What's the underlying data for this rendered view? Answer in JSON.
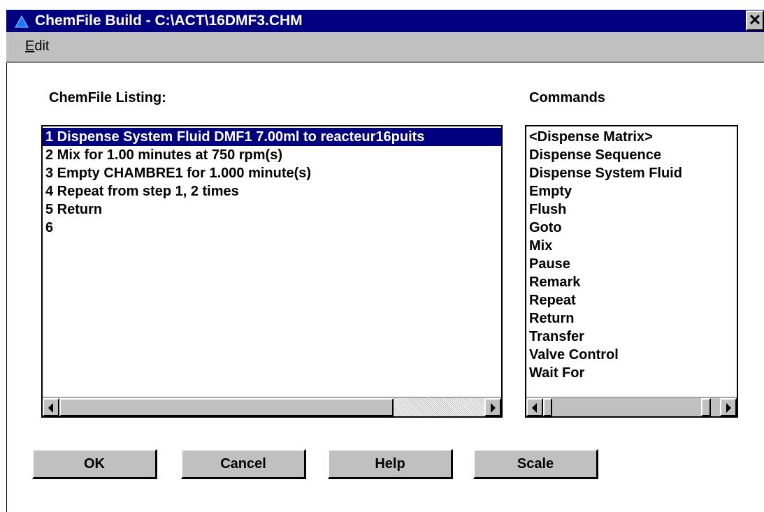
{
  "window": {
    "title": "ChemFile Build - C:\\ACT\\16DMF3.CHM",
    "close_label": "✕"
  },
  "menu": {
    "edit_first": "E",
    "edit_rest": "dit"
  },
  "listing": {
    "label": "ChemFile Listing:",
    "items": [
      "1 Dispense System Fluid DMF1 7.00ml to reacteur16puits",
      "2 Mix for 1.00 minutes  at 750 rpm(s)",
      "3 Empty CHAMBRE1 for 1.000 minute(s)",
      "4 Repeat from step 1, 2 times",
      "5 Return",
      "6"
    ],
    "selected_index": 0
  },
  "commands": {
    "label": "Commands",
    "items": [
      "<Dispense Matrix>",
      "Dispense Sequence",
      "Dispense System Fluid",
      "Empty",
      "Flush",
      "Goto",
      "Mix",
      "Pause",
      "Remark",
      "Repeat",
      "Return",
      "Transfer",
      "Valve Control",
      "Wait For"
    ]
  },
  "buttons": {
    "ok": "OK",
    "cancel": "Cancel",
    "help": "Help",
    "scale": "Scale"
  },
  "colors": {
    "titlebar": "#000080",
    "face": "#c0c0c0",
    "selection": "#000080"
  },
  "icons": {
    "app": "triangle-app-icon",
    "close": "close-icon"
  }
}
